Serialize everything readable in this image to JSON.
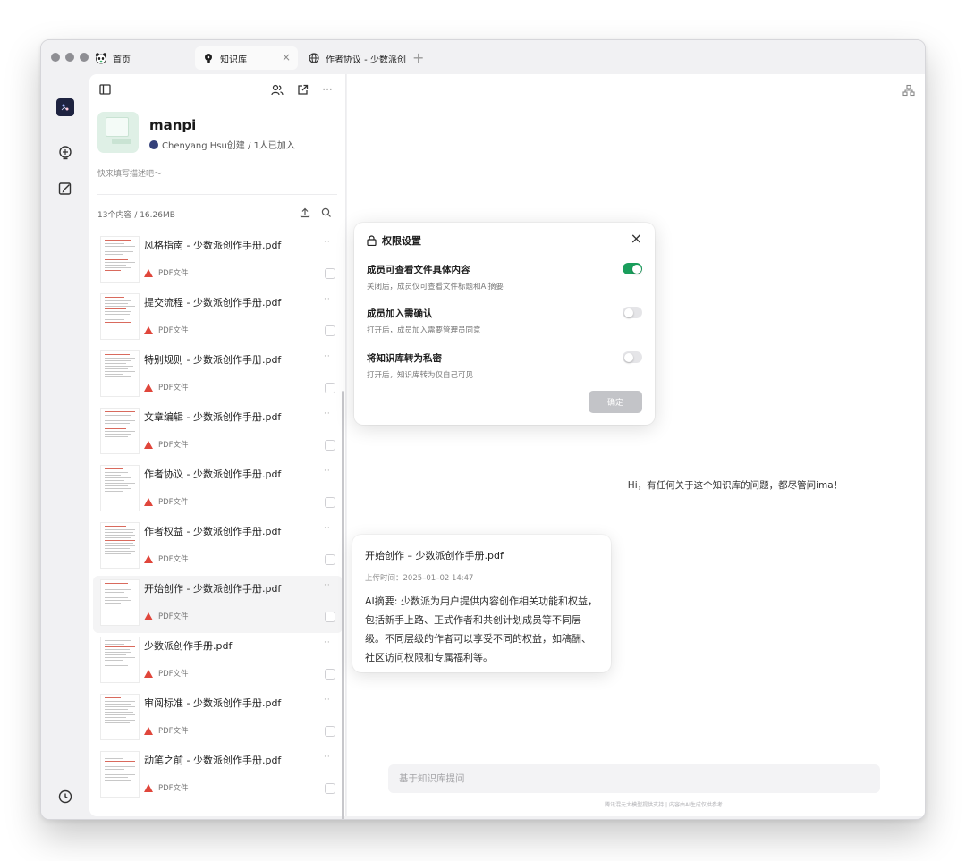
{
  "tabs": [
    {
      "label": "首页",
      "icon": "panda-icon"
    },
    {
      "label": "知识库",
      "icon": "bulb-icon",
      "active": true
    },
    {
      "label": "作者协议 - 少数派创",
      "icon": "globe-icon"
    }
  ],
  "tab_close": "×",
  "new_tab": "+",
  "rail": {
    "icons": [
      "avatar-icon",
      "knowledge-icon",
      "edit-icon",
      "history-icon"
    ]
  },
  "panel": {
    "kb_name": "manpi",
    "kb_meta": "Chenyang Hsu创建 / 1人已加入",
    "kb_desc": "快来填写描述吧～",
    "stats": "13个内容 / 16.26MB",
    "more_label": "···",
    "items": [
      {
        "title": "风格指南 - 少数派创作手册.pdf",
        "type": "PDF文件"
      },
      {
        "title": "提交流程 - 少数派创作手册.pdf",
        "type": "PDF文件"
      },
      {
        "title": "特别规则 - 少数派创作手册.pdf",
        "type": "PDF文件"
      },
      {
        "title": "文章编辑 - 少数派创作手册.pdf",
        "type": "PDF文件"
      },
      {
        "title": "作者协议 - 少数派创作手册.pdf",
        "type": "PDF文件"
      },
      {
        "title": "作者权益 - 少数派创作手册.pdf",
        "type": "PDF文件"
      },
      {
        "title": "开始创作 - 少数派创作手册.pdf",
        "type": "PDF文件",
        "selected": true
      },
      {
        "title": "少数派创作手册.pdf",
        "type": "PDF文件"
      },
      {
        "title": "审阅标准 - 少数派创作手册.pdf",
        "type": "PDF文件"
      },
      {
        "title": "动笔之前 - 少数派创作手册.pdf",
        "type": "PDF文件"
      }
    ]
  },
  "dialog": {
    "title": "权限设置",
    "close": "×",
    "options": [
      {
        "label": "成员可查看文件具体内容",
        "desc": "关闭后，成员仅可查看文件标题和AI摘要",
        "on": true
      },
      {
        "label": "成员加入需确认",
        "desc": "打开后，成员加入需要管理员同意",
        "on": false
      },
      {
        "label": "将知识库转为私密",
        "desc": "打开后，知识库转为仅自己可见",
        "on": false
      }
    ],
    "confirm": "确定"
  },
  "main": {
    "welcome": "Hi，有任何关于这个知识库的问题，都尽管问ima！",
    "ask_placeholder": "基于知识库提问",
    "footer": "腾讯混元大模型提供支持 | 内容由AI生成仅供参考"
  },
  "preview": {
    "title": "开始创作 – 少数派创作手册.pdf",
    "time": "上传时间：2025–01–02 14:47",
    "summary": "AI摘要: 少数派为用户提供内容创作相关功能和权益，包括新手上路、正式作者和共创计划成员等不同层级。不同层级的作者可以享受不同的权益，如稿酬、社区访问权限和专属福利等。"
  },
  "colors": {
    "accent_green": "#1a9e5c",
    "pdf_red": "#e0463b",
    "confirm_disabled": "#c3c4c8"
  }
}
